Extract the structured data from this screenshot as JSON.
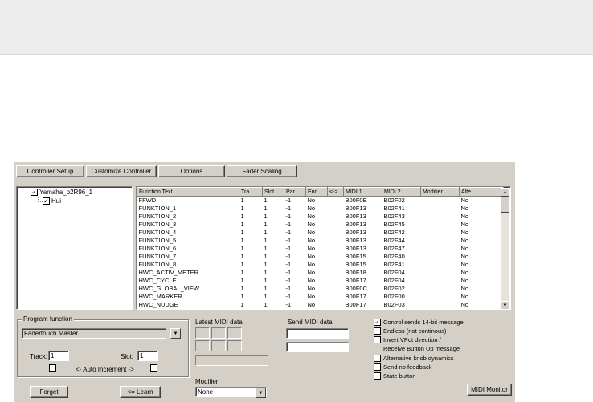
{
  "tabs": [
    "Controller Setup",
    "Customize Controller",
    "Options",
    "Fader Scaling"
  ],
  "tree": {
    "root": {
      "label": "Yamaha_o2R96_1",
      "checked": true
    },
    "child": {
      "label": "Hui",
      "checked": true
    }
  },
  "grid": {
    "columns": [
      "Function Text",
      "Tra...",
      "Slot...",
      "Par...",
      "End...",
      "<->",
      "MIDI 1",
      "MIDI 2",
      "Modifier",
      "Alte..."
    ],
    "rows": [
      [
        "FFWD",
        "1",
        "1",
        "-1",
        "No",
        "",
        "B00F0E",
        "B02F02",
        "",
        "No"
      ],
      [
        "FUNKTION_1",
        "1",
        "1",
        "-1",
        "No",
        "",
        "B00F13",
        "B02F41",
        "",
        "No"
      ],
      [
        "FUNKTION_2",
        "1",
        "1",
        "-1",
        "No",
        "",
        "B00F13",
        "B02F43",
        "",
        "No"
      ],
      [
        "FUNKTION_3",
        "1",
        "1",
        "-1",
        "No",
        "",
        "B00F13",
        "B02F45",
        "",
        "No"
      ],
      [
        "FUNKTION_4",
        "1",
        "1",
        "-1",
        "No",
        "",
        "B00F13",
        "B02F42",
        "",
        "No"
      ],
      [
        "FUNKTION_5",
        "1",
        "1",
        "-1",
        "No",
        "",
        "B00F13",
        "B02F44",
        "",
        "No"
      ],
      [
        "FUNKTION_6",
        "1",
        "1",
        "-1",
        "No",
        "",
        "B00F13",
        "B02F47",
        "",
        "No"
      ],
      [
        "FUNKTION_7",
        "1",
        "1",
        "-1",
        "No",
        "",
        "B00F15",
        "B02F40",
        "",
        "No"
      ],
      [
        "FUNKTION_8",
        "1",
        "1",
        "-1",
        "No",
        "",
        "B00F15",
        "B02F41",
        "",
        "No"
      ],
      [
        "HWC_ACTIV_METER",
        "1",
        "1",
        "-1",
        "No",
        "",
        "B00F18",
        "B02F04",
        "",
        "No"
      ],
      [
        "HWC_CYCLE",
        "1",
        "1",
        "-1",
        "No",
        "",
        "B00F17",
        "B02F04",
        "",
        "No"
      ],
      [
        "HWC_GLOBAL_VIEW",
        "1",
        "1",
        "-1",
        "No",
        "",
        "B00F0C",
        "B02F02",
        "",
        "No"
      ],
      [
        "HWC_MARKER",
        "1",
        "1",
        "-1",
        "No",
        "",
        "B00F17",
        "B02F00",
        "",
        "No"
      ],
      [
        "HWC_NUDGE",
        "1",
        "1",
        "-1",
        "No",
        "",
        "B00F17",
        "B02F03",
        "",
        "No"
      ]
    ]
  },
  "program": {
    "legend": "Program function",
    "value": "Fadertouch Master",
    "track_label": "Track:",
    "track_value": "1",
    "slot_label": "Slot:",
    "slot_value": "1",
    "auto_increment": "<- Auto Increment ->"
  },
  "latest_midi": {
    "label": "Latest MIDI data"
  },
  "send_midi": {
    "label": "Send MIDI data"
  },
  "modifier": {
    "label": "Modifier:",
    "value": "None"
  },
  "options": [
    {
      "label": "Control sends 14-bit message",
      "checked": true
    },
    {
      "label": "Endless (not continous)",
      "checked": false
    },
    {
      "label": "Invert VPot direction /",
      "checked": false
    },
    {
      "label": "Receive Button Up message",
      "checked": null
    },
    {
      "label": "Alternative knob dynamics",
      "checked": false
    },
    {
      "label": "Send no feedback",
      "checked": false
    },
    {
      "label": "State button",
      "checked": false
    }
  ],
  "buttons": {
    "forget": "Forget",
    "learn": "<= Learn",
    "midi_monitor": "MIDI Monitor"
  },
  "icons": {
    "check": "✓",
    "arrow_down": "▼",
    "arrow_up": "▲"
  }
}
